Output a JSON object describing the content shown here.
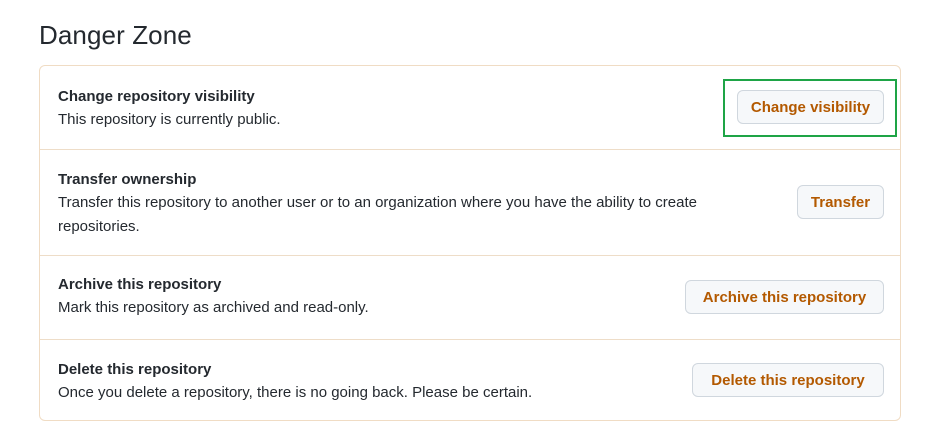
{
  "heading": "Danger Zone",
  "rows": [
    {
      "title": "Change repository visibility",
      "description": "This repository is currently public.",
      "button": "Change visibility"
    },
    {
      "title": "Transfer ownership",
      "description": "Transfer this repository to another user or to an organization where you have the ability to create repositories.",
      "button": "Transfer"
    },
    {
      "title": "Archive this repository",
      "description": "Mark this repository as archived and read-only.",
      "button": "Archive this repository"
    },
    {
      "title": "Delete this repository",
      "description": "Once you delete a repository, there is no going back. Please be certain.",
      "button": "Delete this repository"
    }
  ],
  "colors": {
    "danger_text": "#b35900",
    "zone_border": "#f0dcc4",
    "highlight": "#1ea446"
  }
}
